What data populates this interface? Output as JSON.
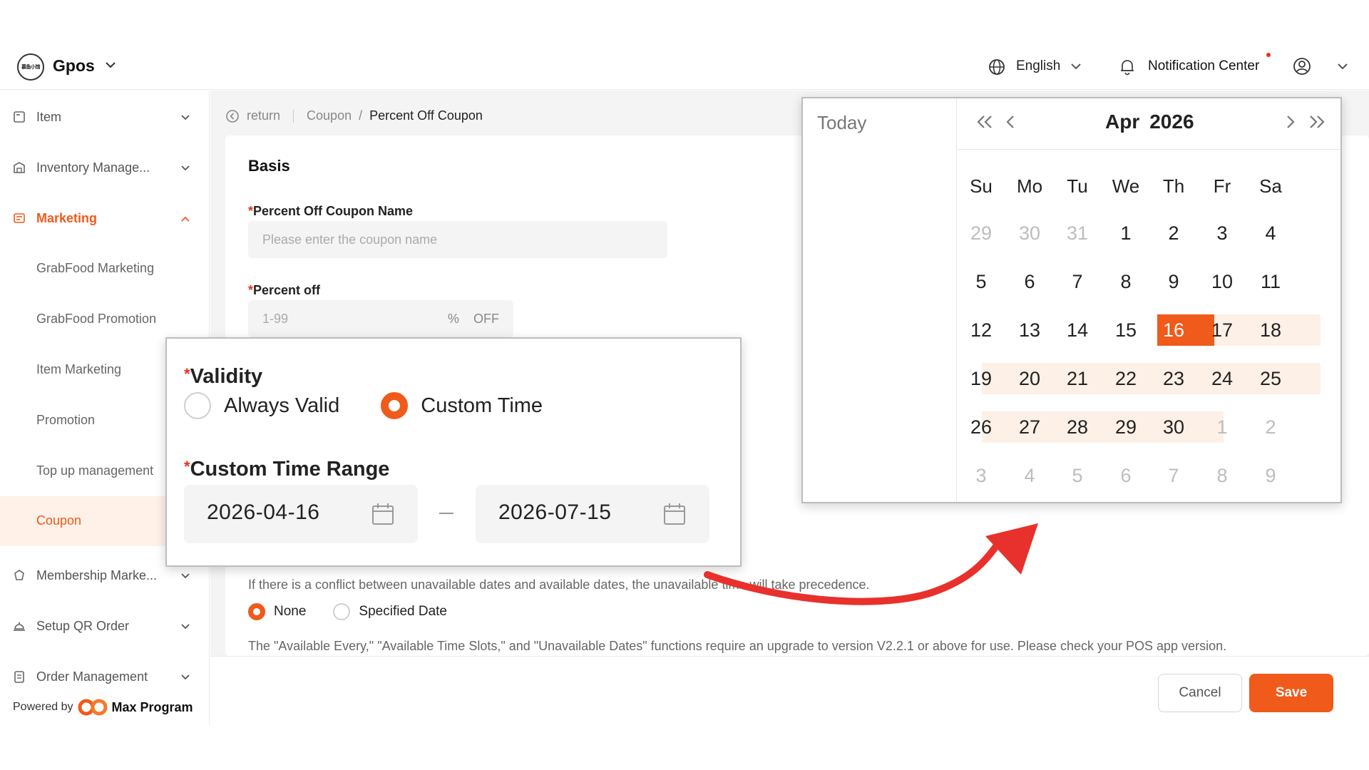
{
  "header": {
    "logo_text": "慕鱼小馆",
    "brand": "Gpos",
    "language": "English",
    "notification": "Notification Center"
  },
  "sidebar": {
    "items": [
      {
        "label": "Item",
        "icon": "item-icon"
      },
      {
        "label": "Inventory Manage...",
        "icon": "warehouse-icon"
      },
      {
        "label": "Marketing",
        "icon": "marketing-icon",
        "active": true
      },
      {
        "label": "Membership Marke...",
        "icon": "membership-icon"
      },
      {
        "label": "Setup QR Order",
        "icon": "bell-tray-icon"
      },
      {
        "label": "Order Management",
        "icon": "clipboard-icon"
      }
    ],
    "subitems": [
      "GrabFood Marketing",
      "GrabFood Promotion",
      "Item Marketing",
      "Promotion",
      "Top up management",
      "Coupon"
    ],
    "powered_by": "Powered by",
    "powered_brand": "Max Program"
  },
  "breadcrumb": {
    "return": "return",
    "parent": "Coupon",
    "separator": "/",
    "current": "Percent Off Coupon"
  },
  "form": {
    "section": "Basis",
    "name_label": "Percent Off Coupon Name",
    "name_placeholder": "Please enter the coupon name",
    "percent_label": "Percent off",
    "percent_placeholder": "1-99",
    "percent_suffix_symbol": "%",
    "percent_suffix": "OFF",
    "required_mark": "*",
    "conflict_note": "If there is a conflict between unavailable dates and available dates, the unavailable time will take precedence.",
    "unavailable_options": [
      "None",
      "Specified Date"
    ],
    "unavailable_selected": "None",
    "version_note": "The \"Available Every,\" \"Available Time Slots,\" and \"Unavailable Dates\" functions require an upgrade to version V2.2.1 or above for use. Please check your POS app version."
  },
  "validity": {
    "label": "Validity",
    "options": [
      "Always Valid",
      "Custom Time"
    ],
    "selected": "Custom Time",
    "range_label": "Custom Time Range",
    "start": "2026-04-16",
    "end": "2026-07-15",
    "range_sep": "–"
  },
  "calendar": {
    "today": "Today",
    "month": "Apr",
    "year": "2026",
    "weekdays": [
      "Su",
      "Mo",
      "Tu",
      "We",
      "Th",
      "Fr",
      "Sa"
    ],
    "weeks": [
      [
        "29",
        "30",
        "31",
        "1",
        "2",
        "3",
        "4"
      ],
      [
        "5",
        "6",
        "7",
        "8",
        "9",
        "10",
        "11"
      ],
      [
        "12",
        "13",
        "14",
        "15",
        "16",
        "17",
        "18"
      ],
      [
        "19",
        "20",
        "21",
        "22",
        "23",
        "24",
        "25"
      ],
      [
        "26",
        "27",
        "28",
        "29",
        "30",
        "1",
        "2"
      ],
      [
        "3",
        "4",
        "5",
        "6",
        "7",
        "8",
        "9"
      ]
    ],
    "selected_day": "16",
    "accent": "#f05a1a",
    "range_fill": "#fdf0e6"
  },
  "footer": {
    "cancel": "Cancel",
    "save": "Save"
  }
}
